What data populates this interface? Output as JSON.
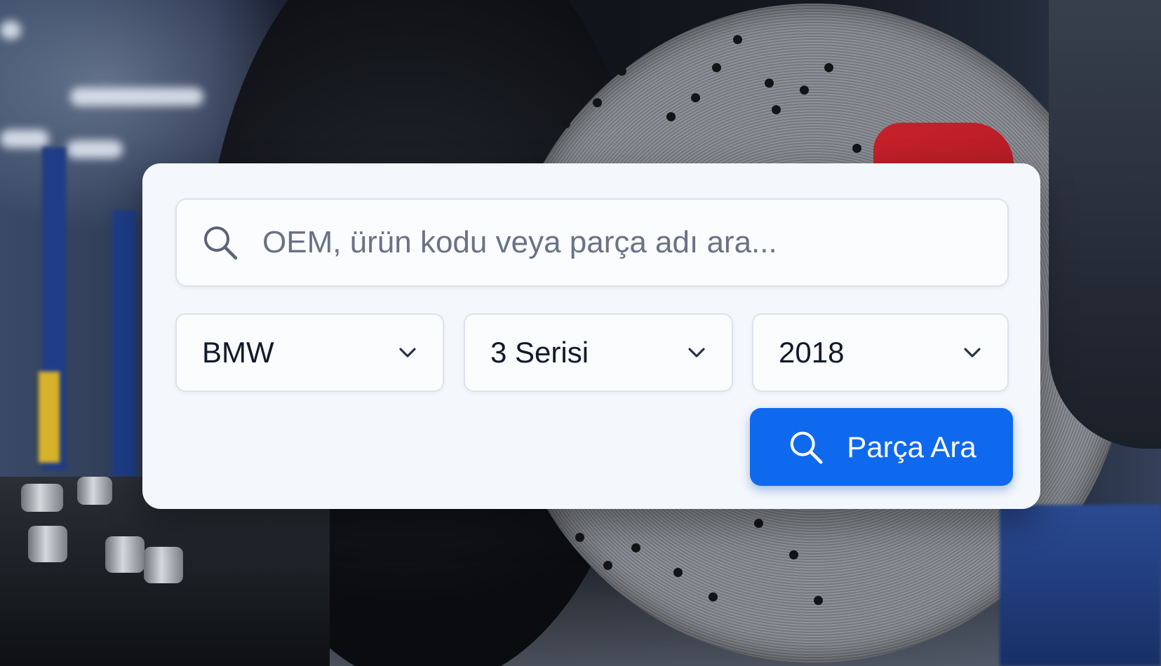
{
  "search": {
    "placeholder": "OEM, ürün kodu veya parça adı ara...",
    "value": ""
  },
  "filters": {
    "brand": "BMW",
    "model": "3 Serisi",
    "year": "2018"
  },
  "submit": {
    "label": "Parça Ara"
  },
  "icons": {
    "search_field": "search-icon",
    "dropdown": "chevron-down-icon",
    "submit": "search-icon"
  },
  "colors": {
    "accent": "#0f69ee",
    "card_background": "#f4f7fb",
    "text_primary": "#12192a",
    "placeholder": "#6a7286"
  }
}
